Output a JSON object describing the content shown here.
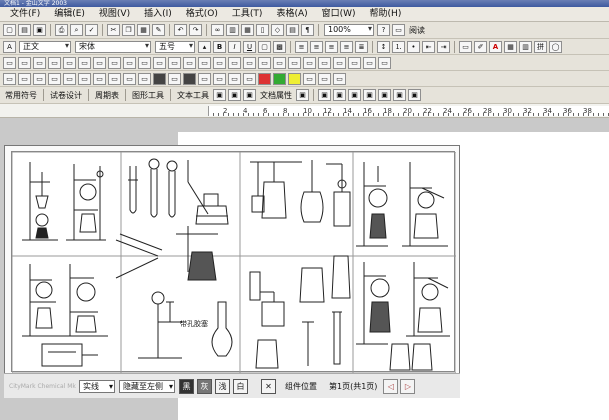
{
  "window": {
    "title": "文档1 - 金山文字 2003"
  },
  "menubar": {
    "items": [
      "文件(F)",
      "编辑(E)",
      "视图(V)",
      "插入(I)",
      "格式(O)",
      "工具(T)",
      "表格(A)",
      "窗口(W)",
      "帮助(H)"
    ]
  },
  "toolbar_standard": {
    "zoom_value": "100%",
    "read_label": "阅读"
  },
  "toolbar_format": {
    "style_value": "正文",
    "font_value": "宋体",
    "size_value": "五号",
    "bold_label": "B",
    "italic_label": "I",
    "underline_label": "U",
    "font_color_label": "A"
  },
  "toolbar_custom": {
    "items": [
      "常用符号",
      "试卷设计",
      "周期表",
      "图形工具",
      "文本工具",
      "文档属性"
    ]
  },
  "ruler": {
    "numbers": [
      "2",
      "4",
      "6",
      "8",
      "10",
      "12",
      "14",
      "16",
      "18",
      "20",
      "22",
      "24",
      "26",
      "28",
      "30",
      "32",
      "34",
      "36",
      "38"
    ]
  },
  "library_panel": {
    "annotation_label": "带孔胶塞",
    "bottom": {
      "logo_text": "CityMark Chemical Mk",
      "line_style": "实线",
      "position_option": "隐藏至左侧",
      "color_button_1": "黑",
      "color_button_2": "灰",
      "color_button_3": "浅",
      "color_button_4": "白",
      "close_label": "✕",
      "position_label": "组件位置",
      "page_info": "第1页(共1页)",
      "prev_label": "◁",
      "next_label": "▷"
    }
  }
}
